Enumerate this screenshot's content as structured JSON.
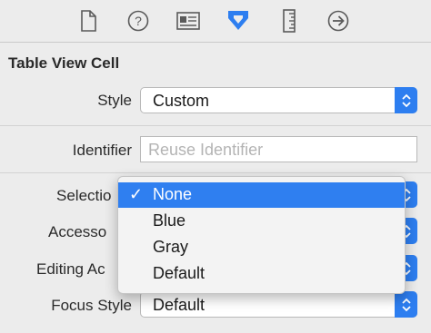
{
  "toolbar": {
    "icons": [
      {
        "name": "file-inspector-icon"
      },
      {
        "name": "quick-help-icon"
      },
      {
        "name": "identity-inspector-icon"
      },
      {
        "name": "attributes-inspector-icon",
        "active": true
      },
      {
        "name": "size-inspector-icon"
      },
      {
        "name": "connections-inspector-icon"
      }
    ],
    "accent": "#2d7ef0"
  },
  "section": {
    "title": "Table View Cell"
  },
  "style": {
    "label": "Style",
    "value": "Custom"
  },
  "identifier": {
    "label": "Identifier",
    "value": "",
    "placeholder": "Reuse Identifier"
  },
  "selection": {
    "label": "Selectio"
  },
  "accessory": {
    "label": "Accesso"
  },
  "editing_accessory": {
    "label": "Editing Ac"
  },
  "focus_style": {
    "label": "Focus Style",
    "value": "Default"
  },
  "selection_menu": {
    "check": "✓",
    "selected": "None",
    "options": [
      "None",
      "Blue",
      "Gray",
      "Default"
    ]
  }
}
